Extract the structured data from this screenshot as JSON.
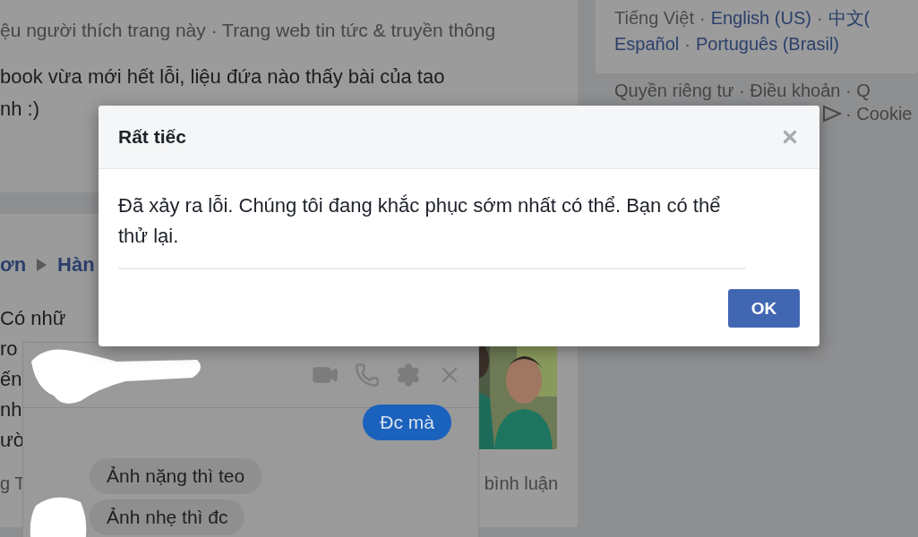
{
  "background_page": {
    "post": {
      "meta": "ệu người thích trang này · Trang web tin tức & truyền thông",
      "text_lines": [
        "book vừa mới hết lỗi, liệu đứa nào thấy bài của tao",
        "nh :)"
      ]
    },
    "second_post": {
      "breadcrumb": [
        "ơn",
        "Hàn"
      ],
      "text_fragments": [
        "Có nhữ",
        "ro",
        "ến",
        "nh",
        "ườ"
      ],
      "footer_fragment": "g T",
      "comments": "bình luận"
    },
    "language_separator": "·",
    "languages": [
      {
        "label": "Tiếng Việt",
        "selected": true
      },
      {
        "label": "English (US)",
        "selected": false
      },
      {
        "label": "中文(",
        "selected": false
      },
      {
        "label": "Español",
        "selected": false
      },
      {
        "label": "Português (Brasil)",
        "selected": false
      }
    ],
    "footer_links": [
      "Quyền riêng tư · Điều khoản · Q",
      "· Cookie"
    ]
  },
  "chat": {
    "messages": [
      {
        "kind": "sent",
        "text": "Đc mà"
      },
      {
        "kind": "received",
        "text": "Ảnh nặng thì teo"
      },
      {
        "kind": "received",
        "text": "Ảnh nhẹ thì đc"
      }
    ]
  },
  "dialog": {
    "title": "Rất tiếc",
    "message": "Đã xảy ra lỗi. Chúng tôi đang khắc phục sớm nhất có thể. Bạn có thể thử lại.",
    "button": "OK"
  }
}
